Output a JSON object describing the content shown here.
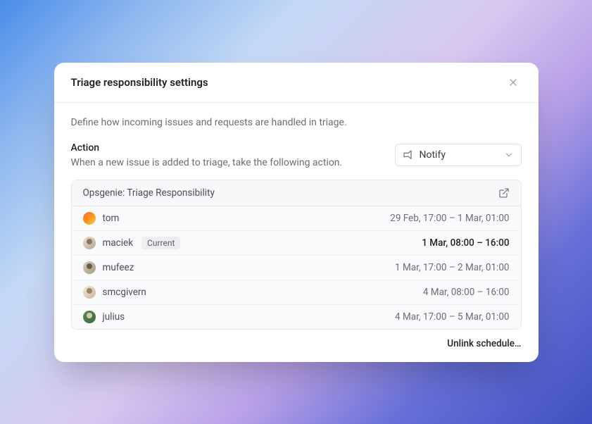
{
  "modal": {
    "title": "Triage responsibility settings",
    "description": "Define how incoming issues and requests are handled in triage."
  },
  "action": {
    "label": "Action",
    "description": "When a new issue is added to triage, take the following action.",
    "selected": "Notify"
  },
  "schedule": {
    "title": "Opsgenie: Triage Responsibility",
    "current_badge": "Current",
    "rows": [
      {
        "name": "tom",
        "time": "29 Feb, 17:00 – 1 Mar, 01:00",
        "current": false
      },
      {
        "name": "maciek",
        "time": "1 Mar, 08:00 – 16:00",
        "current": true
      },
      {
        "name": "mufeez",
        "time": "1 Mar, 17:00 – 2 Mar, 01:00",
        "current": false
      },
      {
        "name": "smcgivern",
        "time": "4 Mar, 08:00 – 16:00",
        "current": false
      },
      {
        "name": "julius",
        "time": "4 Mar, 17:00 – 5 Mar, 01:00",
        "current": false
      }
    ]
  },
  "footer": {
    "unlink": "Unlink schedule…"
  }
}
